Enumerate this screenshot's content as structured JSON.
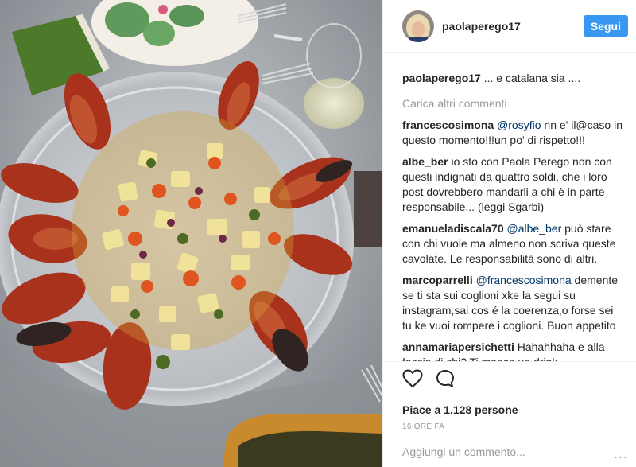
{
  "header": {
    "username": "paolaperego17",
    "follow_label": "Segui"
  },
  "caption": {
    "username": "paolaperego17",
    "text": " ... e catalana sia ...."
  },
  "load_more_label": "Carica altri commenti",
  "comments": [
    {
      "user": "francescosimona",
      "mention": "@rosyfio",
      "text": " nn e' il@caso in questo momento!!!un po' di rispetto!!!"
    },
    {
      "user": "albe_ber",
      "mention": "",
      "text": " io sto con Paola Perego non con questi indignati da quattro soldi, che i loro post dovrebbero mandarli a chi è in parte responsabile... (leggi Sgarbi)"
    },
    {
      "user": "emanueladiscala70",
      "mention": "@albe_ber",
      "text": " può stare con chi vuole ma almeno non scriva queste cavolate. Le responsabilità sono di altri."
    },
    {
      "user": "marcoparrelli",
      "mention": "@francescosimona",
      "text": " demente se ti sta sui coglioni xke la segui su instagram,sai cos é la coerenza,o forse sei tu ke vuoi rompere i coglioni. Buon appetito"
    },
    {
      "user": "annamariapersichetti",
      "mention": "",
      "text": " Hahahhaha e alla faccia di chi? Ti manca un drink. ...."
    }
  ],
  "actions": {
    "like_icon": "heart-icon",
    "comment_icon": "comment-icon",
    "likes_text": "Piace a 1.128 persone",
    "time_text": "16 ORE FA"
  },
  "add_comment": {
    "placeholder": "Aggiungi un commento...",
    "menu_label": "..."
  },
  "colors": {
    "accent": "#3897f0",
    "mention": "#003569",
    "muted": "#999999",
    "text": "#262626"
  }
}
